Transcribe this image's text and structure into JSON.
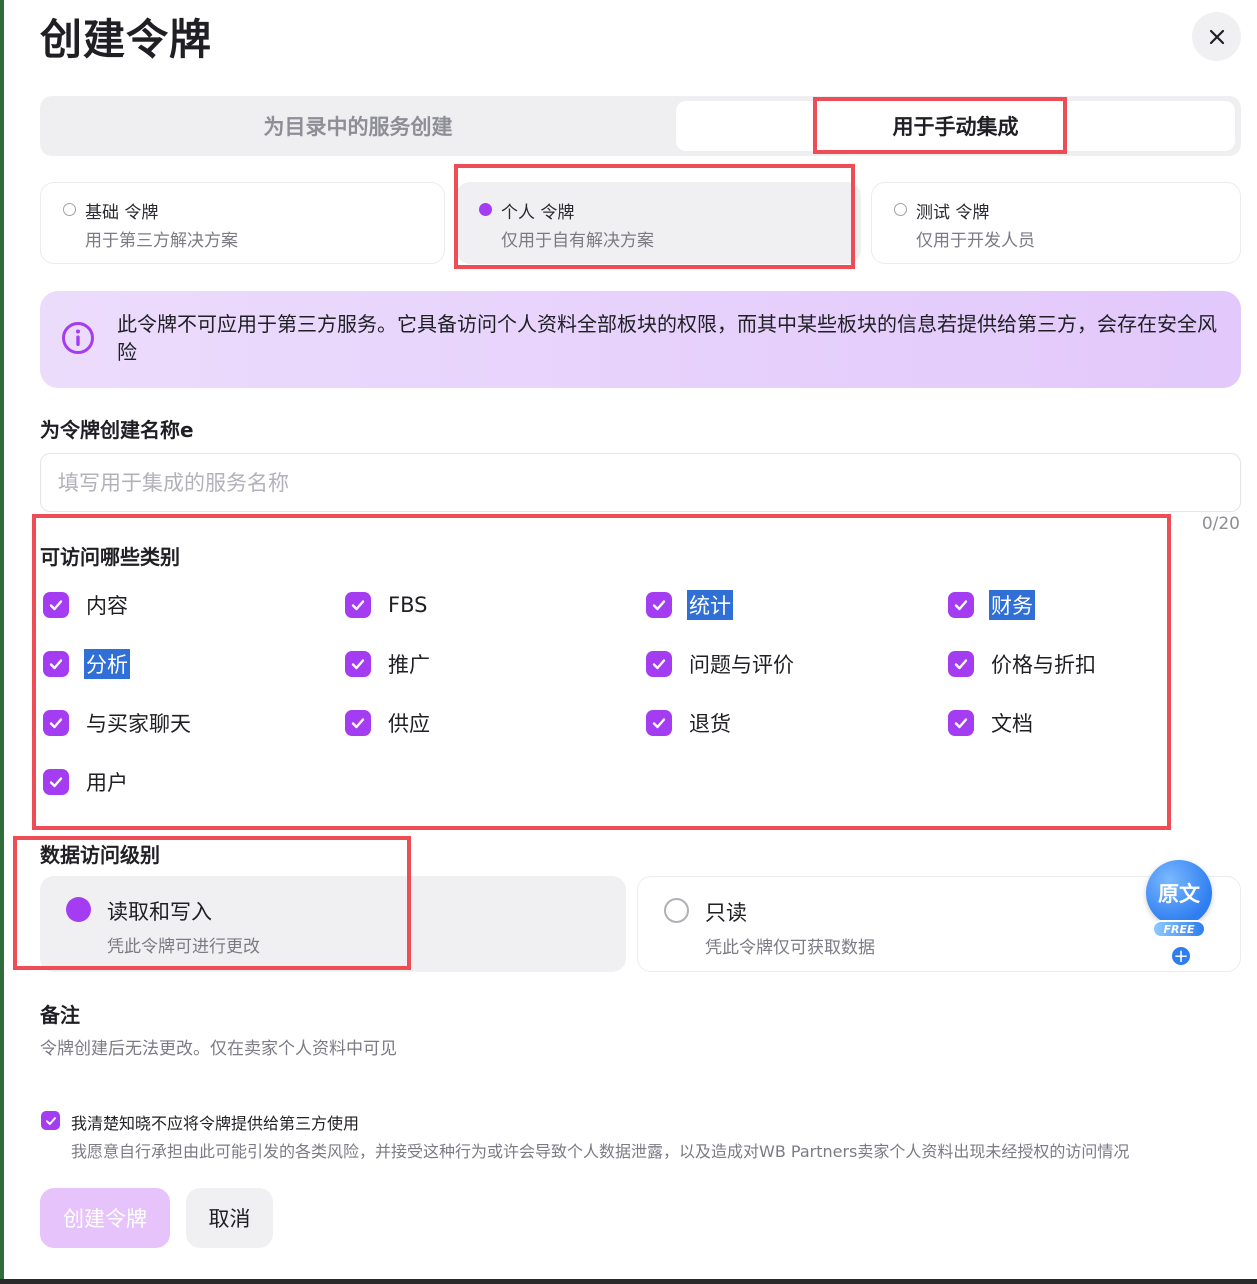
{
  "dialog": {
    "title": "创建令牌",
    "close_icon": "close-icon"
  },
  "tabs": [
    {
      "label": "为目录中的服务创建",
      "active": false
    },
    {
      "label": "用于手动集成",
      "active": true
    }
  ],
  "token_types": [
    {
      "title": "基础 令牌",
      "subtitle": "用于第三方解决方案",
      "selected": false
    },
    {
      "title": "个人 令牌",
      "subtitle": "仅用于自有解决方案",
      "selected": true
    },
    {
      "title": "测试 令牌",
      "subtitle": "仅用于开发人员",
      "selected": false
    }
  ],
  "alert": {
    "icon": "info-icon",
    "text": "此令牌不可应用于第三方服务。它具备访问个人资料全部板块的权限，而其中某些板块的信息若提供给第三方，会存在安全风险"
  },
  "name_field": {
    "label": "为令牌创建名称e",
    "placeholder": "填写用于集成的服务名称",
    "value": "",
    "counter": "0/20"
  },
  "categories": {
    "label": "可访问哪些类别",
    "items": [
      {
        "label": "内容",
        "checked": true
      },
      {
        "label": "FBS",
        "checked": true
      },
      {
        "label": "统计",
        "checked": true
      },
      {
        "label": "财务",
        "checked": true
      },
      {
        "label": "分析",
        "checked": true
      },
      {
        "label": "推广",
        "checked": true
      },
      {
        "label": "问题与评价",
        "checked": true
      },
      {
        "label": "价格与折扣",
        "checked": true
      },
      {
        "label": "与买家聊天",
        "checked": true
      },
      {
        "label": "供应",
        "checked": true
      },
      {
        "label": "退货",
        "checked": true
      },
      {
        "label": "文档",
        "checked": true
      },
      {
        "label": "用户",
        "checked": true
      }
    ]
  },
  "access_level": {
    "label": "数据访问级别",
    "options": [
      {
        "title": "读取和写入",
        "subtitle": "凭此令牌可进行更改",
        "selected": true
      },
      {
        "title": "只读",
        "subtitle": "凭此令牌仅可获取数据",
        "selected": false
      }
    ]
  },
  "translate_widget": {
    "label": "原文",
    "tag": "FREE",
    "plus": "+"
  },
  "note": {
    "label": "备注",
    "text": "令牌创建后无法更改。仅在卖家个人资料中可见"
  },
  "acknowledgement": {
    "checked": true,
    "title": "我清楚知晓不应将令牌提供给第三方使用",
    "text": "我愿意自行承担由此可能引发的各类风险，并接受这种行为或许会导致个人数据泄露，以及造成对WB Partners卖家个人资料出现未经授权的访问情况"
  },
  "actions": {
    "create": "创建令牌",
    "cancel": "取消"
  },
  "colors": {
    "accent": "#a43cf2",
    "highlight": "#ef4d55",
    "selection": "#2f6fd6"
  }
}
